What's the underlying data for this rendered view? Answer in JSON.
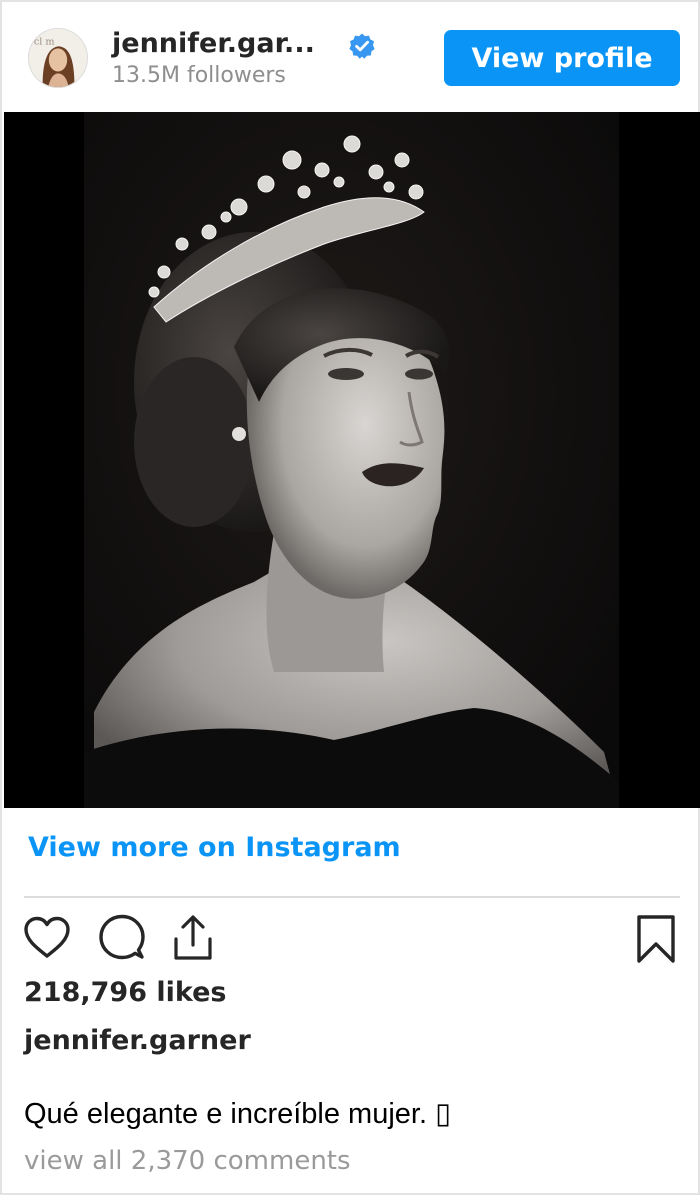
{
  "header": {
    "username": "jennifer.gar...",
    "followers": "13.5M followers",
    "view_profile_label": "View profile",
    "avatar_text": "cl m"
  },
  "post": {
    "view_more_label": "View more on Instagram",
    "likes": "218,796 likes",
    "author": "jennifer.garner",
    "caption": "Qué elegante e increíble mujer. ▯",
    "comments_link": "view all 2,370 comments"
  },
  "colors": {
    "accent": "#0a95f6",
    "verified": "#3897f0",
    "muted": "#8e8e8e"
  },
  "icons": [
    "verified-badge-icon",
    "heart-icon",
    "comment-icon",
    "share-icon",
    "bookmark-icon"
  ]
}
